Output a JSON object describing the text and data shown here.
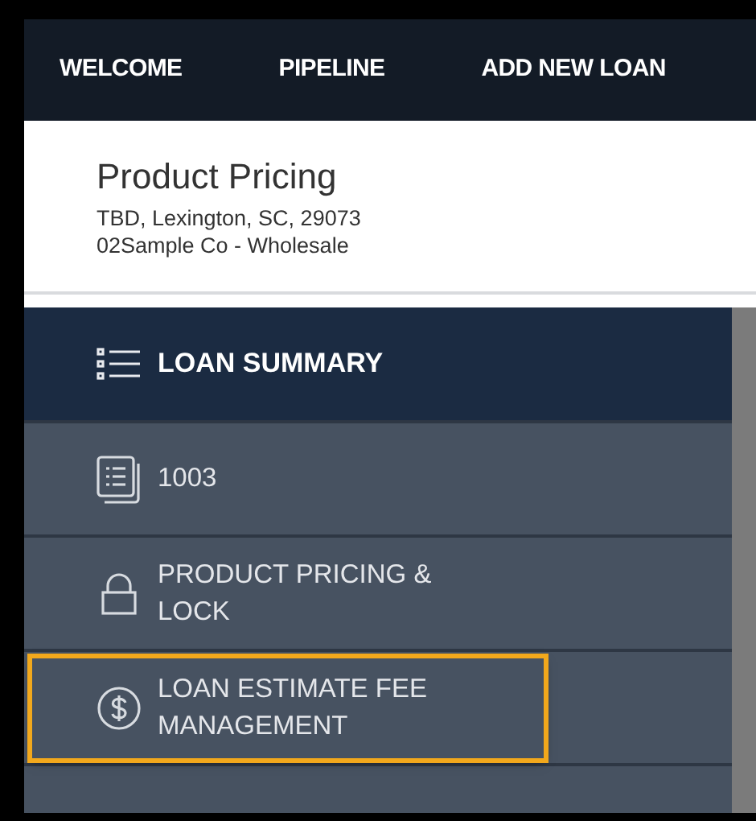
{
  "nav": {
    "items": [
      {
        "label": "WELCOME"
      },
      {
        "label": "PIPELINE"
      },
      {
        "label": "ADD NEW LOAN"
      }
    ]
  },
  "header": {
    "title": "Product Pricing",
    "address": "TBD, Lexington, SC, 29073",
    "company": "02Sample Co - Wholesale"
  },
  "sidebar": {
    "heading": {
      "label": "LOAN SUMMARY",
      "kind": "list"
    },
    "items": [
      {
        "label": "1003",
        "kind": "form",
        "highlighted": false
      },
      {
        "label": "PRODUCT PRICING & LOCK",
        "kind": "lock",
        "highlighted": false
      },
      {
        "label": "LOAN ESTIMATE FEE MANAGEMENT",
        "kind": "dollar",
        "highlighted": true
      }
    ]
  }
}
